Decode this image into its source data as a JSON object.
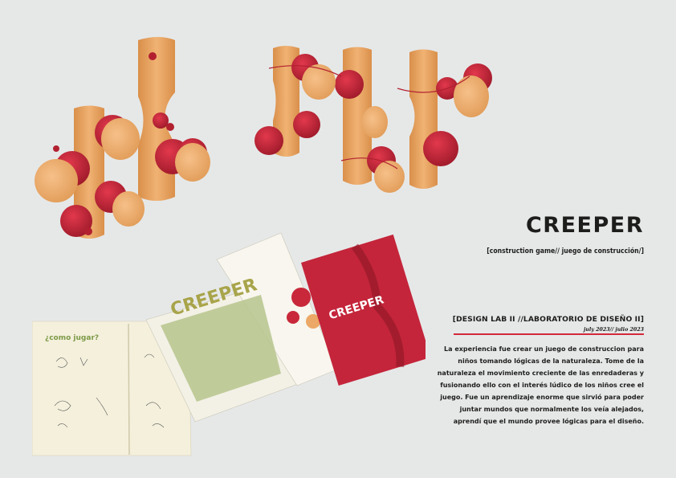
{
  "project": {
    "title": "CREEPER",
    "subtitle": "[construction game// juego de construcción/]",
    "course": "[DESIGN LAB II //LABORATORIO DE DISEÑO II]",
    "date": "july 2023// julio 2023",
    "description": "La experiencia fue crear un juego de construccion para niños tomando lógicas de la naturaleza. Tome de la naturaleza el movimiento creciente de las enredaderas y fusionando ello con el interés lúdico de los niños cree el juego. Fue un aprendizaje enorme que sirvió para poder juntar mundos que normalmente los veía alejados, aprendí que el mundo provee lógicas para el diseño."
  },
  "booklet": {
    "left_page_heading": "¿como jugar?",
    "cover_logo": "CREEPER",
    "spread_logo": "CREEPER"
  },
  "colors": {
    "background": "#e6e8e8",
    "wood": "#eba866",
    "red": "#c8283a",
    "accent_line": "#d4293a",
    "cover": "#c4253a",
    "spread_green": "#a9b87c"
  }
}
